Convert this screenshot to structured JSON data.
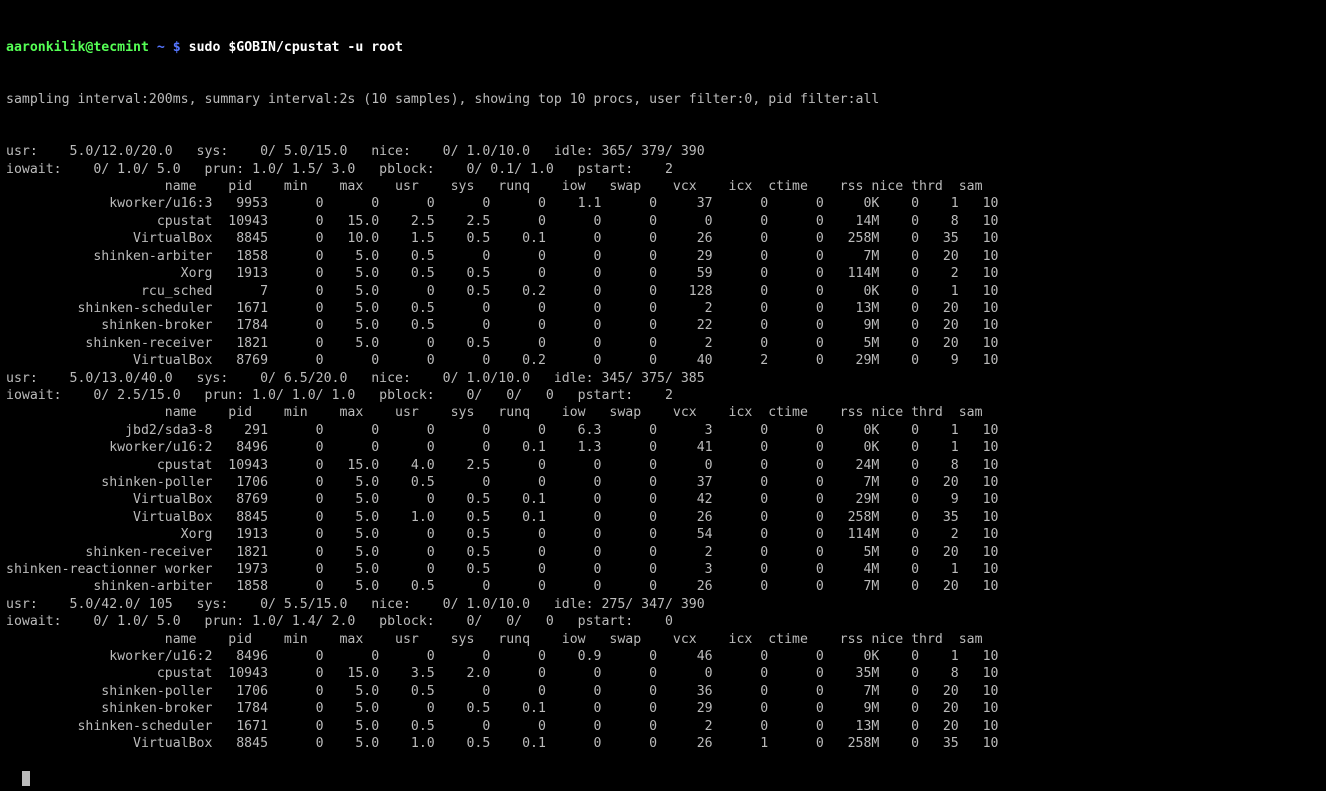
{
  "prompt": {
    "user_host": "aaronkilik@tecmint",
    "sep": " ~ $ ",
    "command": "sudo $GOBIN/cpustat -u root"
  },
  "info_line": "sampling interval:200ms, summary interval:2s (10 samples), showing top 10 procs, user filter:0, pid filter:all",
  "columnHeader": "                    name    pid    min    max    usr    sys   runq    iow   swap    vcx    icx  ctime    rss nice thrd  sam",
  "blocks": [
    {
      "summary": [
        "usr:    5.0/12.0/20.0   sys:    0/ 5.0/15.0   nice:    0/ 1.0/10.0   idle: 365/ 379/ 390",
        "iowait:    0/ 1.0/ 5.0   prun: 1.0/ 1.5/ 3.0   pblock:    0/ 0.1/ 1.0   pstart:    2"
      ],
      "rows": [
        {
          "name": "kworker/u16:3",
          "pid": "9953",
          "min": "0",
          "max": "0",
          "usr": "0",
          "sys": "0",
          "runq": "0",
          "iow": "1.1",
          "swap": "0",
          "vcx": "37",
          "icx": "0",
          "ctime": "0",
          "rss": "0K",
          "nice": "0",
          "thrd": "1",
          "sam": "10"
        },
        {
          "name": "cpustat",
          "pid": "10943",
          "min": "0",
          "max": "15.0",
          "usr": "2.5",
          "sys": "2.5",
          "runq": "0",
          "iow": "0",
          "swap": "0",
          "vcx": "0",
          "icx": "0",
          "ctime": "0",
          "rss": "14M",
          "nice": "0",
          "thrd": "8",
          "sam": "10"
        },
        {
          "name": "VirtualBox",
          "pid": "8845",
          "min": "0",
          "max": "10.0",
          "usr": "1.5",
          "sys": "0.5",
          "runq": "0.1",
          "iow": "0",
          "swap": "0",
          "vcx": "26",
          "icx": "0",
          "ctime": "0",
          "rss": "258M",
          "nice": "0",
          "thrd": "35",
          "sam": "10"
        },
        {
          "name": "shinken-arbiter",
          "pid": "1858",
          "min": "0",
          "max": "5.0",
          "usr": "0.5",
          "sys": "0",
          "runq": "0",
          "iow": "0",
          "swap": "0",
          "vcx": "29",
          "icx": "0",
          "ctime": "0",
          "rss": "7M",
          "nice": "0",
          "thrd": "20",
          "sam": "10"
        },
        {
          "name": "Xorg",
          "pid": "1913",
          "min": "0",
          "max": "5.0",
          "usr": "0.5",
          "sys": "0.5",
          "runq": "0",
          "iow": "0",
          "swap": "0",
          "vcx": "59",
          "icx": "0",
          "ctime": "0",
          "rss": "114M",
          "nice": "0",
          "thrd": "2",
          "sam": "10"
        },
        {
          "name": "rcu_sched",
          "pid": "7",
          "min": "0",
          "max": "5.0",
          "usr": "0",
          "sys": "0.5",
          "runq": "0.2",
          "iow": "0",
          "swap": "0",
          "vcx": "128",
          "icx": "0",
          "ctime": "0",
          "rss": "0K",
          "nice": "0",
          "thrd": "1",
          "sam": "10"
        },
        {
          "name": "shinken-scheduler",
          "pid": "1671",
          "min": "0",
          "max": "5.0",
          "usr": "0.5",
          "sys": "0",
          "runq": "0",
          "iow": "0",
          "swap": "0",
          "vcx": "2",
          "icx": "0",
          "ctime": "0",
          "rss": "13M",
          "nice": "0",
          "thrd": "20",
          "sam": "10"
        },
        {
          "name": "shinken-broker",
          "pid": "1784",
          "min": "0",
          "max": "5.0",
          "usr": "0.5",
          "sys": "0",
          "runq": "0",
          "iow": "0",
          "swap": "0",
          "vcx": "22",
          "icx": "0",
          "ctime": "0",
          "rss": "9M",
          "nice": "0",
          "thrd": "20",
          "sam": "10"
        },
        {
          "name": "shinken-receiver",
          "pid": "1821",
          "min": "0",
          "max": "5.0",
          "usr": "0",
          "sys": "0.5",
          "runq": "0",
          "iow": "0",
          "swap": "0",
          "vcx": "2",
          "icx": "0",
          "ctime": "0",
          "rss": "5M",
          "nice": "0",
          "thrd": "20",
          "sam": "10"
        },
        {
          "name": "VirtualBox",
          "pid": "8769",
          "min": "0",
          "max": "0",
          "usr": "0",
          "sys": "0",
          "runq": "0.2",
          "iow": "0",
          "swap": "0",
          "vcx": "40",
          "icx": "2",
          "ctime": "0",
          "rss": "29M",
          "nice": "0",
          "thrd": "9",
          "sam": "10"
        }
      ]
    },
    {
      "summary": [
        "usr:    5.0/13.0/40.0   sys:    0/ 6.5/20.0   nice:    0/ 1.0/10.0   idle: 345/ 375/ 385",
        "iowait:    0/ 2.5/15.0   prun: 1.0/ 1.0/ 1.0   pblock:    0/   0/   0   pstart:    2"
      ],
      "rows": [
        {
          "name": "jbd2/sda3-8",
          "pid": "291",
          "min": "0",
          "max": "0",
          "usr": "0",
          "sys": "0",
          "runq": "0",
          "iow": "6.3",
          "swap": "0",
          "vcx": "3",
          "icx": "0",
          "ctime": "0",
          "rss": "0K",
          "nice": "0",
          "thrd": "1",
          "sam": "10"
        },
        {
          "name": "kworker/u16:2",
          "pid": "8496",
          "min": "0",
          "max": "0",
          "usr": "0",
          "sys": "0",
          "runq": "0.1",
          "iow": "1.3",
          "swap": "0",
          "vcx": "41",
          "icx": "0",
          "ctime": "0",
          "rss": "0K",
          "nice": "0",
          "thrd": "1",
          "sam": "10"
        },
        {
          "name": "cpustat",
          "pid": "10943",
          "min": "0",
          "max": "15.0",
          "usr": "4.0",
          "sys": "2.5",
          "runq": "0",
          "iow": "0",
          "swap": "0",
          "vcx": "0",
          "icx": "0",
          "ctime": "0",
          "rss": "24M",
          "nice": "0",
          "thrd": "8",
          "sam": "10"
        },
        {
          "name": "shinken-poller",
          "pid": "1706",
          "min": "0",
          "max": "5.0",
          "usr": "0.5",
          "sys": "0",
          "runq": "0",
          "iow": "0",
          "swap": "0",
          "vcx": "37",
          "icx": "0",
          "ctime": "0",
          "rss": "7M",
          "nice": "0",
          "thrd": "20",
          "sam": "10"
        },
        {
          "name": "VirtualBox",
          "pid": "8769",
          "min": "0",
          "max": "5.0",
          "usr": "0",
          "sys": "0.5",
          "runq": "0.1",
          "iow": "0",
          "swap": "0",
          "vcx": "42",
          "icx": "0",
          "ctime": "0",
          "rss": "29M",
          "nice": "0",
          "thrd": "9",
          "sam": "10"
        },
        {
          "name": "VirtualBox",
          "pid": "8845",
          "min": "0",
          "max": "5.0",
          "usr": "1.0",
          "sys": "0.5",
          "runq": "0.1",
          "iow": "0",
          "swap": "0",
          "vcx": "26",
          "icx": "0",
          "ctime": "0",
          "rss": "258M",
          "nice": "0",
          "thrd": "35",
          "sam": "10"
        },
        {
          "name": "Xorg",
          "pid": "1913",
          "min": "0",
          "max": "5.0",
          "usr": "0",
          "sys": "0.5",
          "runq": "0",
          "iow": "0",
          "swap": "0",
          "vcx": "54",
          "icx": "0",
          "ctime": "0",
          "rss": "114M",
          "nice": "0",
          "thrd": "2",
          "sam": "10"
        },
        {
          "name": "shinken-receiver",
          "pid": "1821",
          "min": "0",
          "max": "5.0",
          "usr": "0",
          "sys": "0.5",
          "runq": "0",
          "iow": "0",
          "swap": "0",
          "vcx": "2",
          "icx": "0",
          "ctime": "0",
          "rss": "5M",
          "nice": "0",
          "thrd": "20",
          "sam": "10"
        },
        {
          "name": "shinken-reactionner worker",
          "pid": "1973",
          "min": "0",
          "max": "5.0",
          "usr": "0",
          "sys": "0.5",
          "runq": "0",
          "iow": "0",
          "swap": "0",
          "vcx": "3",
          "icx": "0",
          "ctime": "0",
          "rss": "4M",
          "nice": "0",
          "thrd": "1",
          "sam": "10"
        },
        {
          "name": "shinken-arbiter",
          "pid": "1858",
          "min": "0",
          "max": "5.0",
          "usr": "0.5",
          "sys": "0",
          "runq": "0",
          "iow": "0",
          "swap": "0",
          "vcx": "26",
          "icx": "0",
          "ctime": "0",
          "rss": "7M",
          "nice": "0",
          "thrd": "20",
          "sam": "10"
        }
      ]
    },
    {
      "summary": [
        "usr:    5.0/42.0/ 105   sys:    0/ 5.5/15.0   nice:    0/ 1.0/10.0   idle: 275/ 347/ 390",
        "iowait:    0/ 1.0/ 5.0   prun: 1.0/ 1.4/ 2.0   pblock:    0/   0/   0   pstart:    0"
      ],
      "rows": [
        {
          "name": "kworker/u16:2",
          "pid": "8496",
          "min": "0",
          "max": "0",
          "usr": "0",
          "sys": "0",
          "runq": "0",
          "iow": "0.9",
          "swap": "0",
          "vcx": "46",
          "icx": "0",
          "ctime": "0",
          "rss": "0K",
          "nice": "0",
          "thrd": "1",
          "sam": "10"
        },
        {
          "name": "cpustat",
          "pid": "10943",
          "min": "0",
          "max": "15.0",
          "usr": "3.5",
          "sys": "2.0",
          "runq": "0",
          "iow": "0",
          "swap": "0",
          "vcx": "0",
          "icx": "0",
          "ctime": "0",
          "rss": "35M",
          "nice": "0",
          "thrd": "8",
          "sam": "10"
        },
        {
          "name": "shinken-poller",
          "pid": "1706",
          "min": "0",
          "max": "5.0",
          "usr": "0.5",
          "sys": "0",
          "runq": "0",
          "iow": "0",
          "swap": "0",
          "vcx": "36",
          "icx": "0",
          "ctime": "0",
          "rss": "7M",
          "nice": "0",
          "thrd": "20",
          "sam": "10"
        },
        {
          "name": "shinken-broker",
          "pid": "1784",
          "min": "0",
          "max": "5.0",
          "usr": "0",
          "sys": "0.5",
          "runq": "0.1",
          "iow": "0",
          "swap": "0",
          "vcx": "29",
          "icx": "0",
          "ctime": "0",
          "rss": "9M",
          "nice": "0",
          "thrd": "20",
          "sam": "10"
        },
        {
          "name": "shinken-scheduler",
          "pid": "1671",
          "min": "0",
          "max": "5.0",
          "usr": "0.5",
          "sys": "0",
          "runq": "0",
          "iow": "0",
          "swap": "0",
          "vcx": "2",
          "icx": "0",
          "ctime": "0",
          "rss": "13M",
          "nice": "0",
          "thrd": "20",
          "sam": "10"
        },
        {
          "name": "VirtualBox",
          "pid": "8845",
          "min": "0",
          "max": "5.0",
          "usr": "1.0",
          "sys": "0.5",
          "runq": "0.1",
          "iow": "0",
          "swap": "0",
          "vcx": "26",
          "icx": "1",
          "ctime": "0",
          "rss": "258M",
          "nice": "0",
          "thrd": "35",
          "sam": "10"
        }
      ]
    }
  ],
  "colWidths": {
    "name": 26,
    "pid": 7,
    "min": 7,
    "max": 7,
    "usr": 7,
    "sys": 7,
    "runq": 7,
    "iow": 7,
    "swap": 7,
    "vcx": 7,
    "icx": 7,
    "ctime": 7,
    "rss": 7,
    "nice": 5,
    "thrd": 5,
    "sam": 5
  }
}
